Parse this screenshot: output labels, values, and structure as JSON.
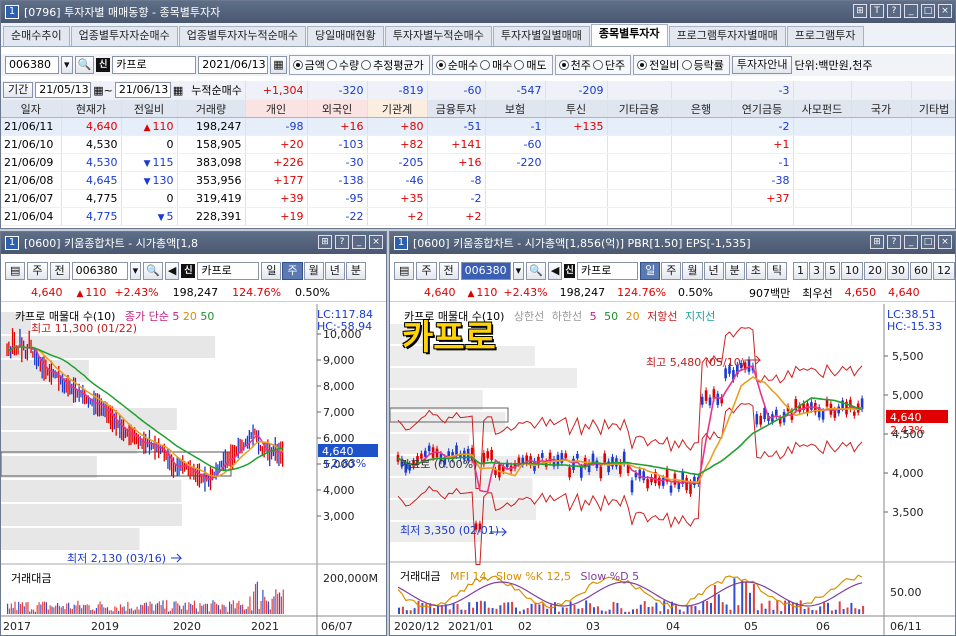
{
  "top": {
    "window_number": "1",
    "title": "[0796] 투자자별 매매동향 - 종목별투자자",
    "tabs": [
      "순매수추이",
      "업종별투자자순매수",
      "업종별투자자누적순매수",
      "당일매매현황",
      "투자자별누적순매수",
      "투자자별일별매매",
      "종목별투자자",
      "프로그램투자자별매매",
      "프로그램투자"
    ],
    "active_tab": 6,
    "code": "006380",
    "name": "카프로",
    "date": "2021/06/13",
    "radios1": [
      {
        "label": "금액",
        "on": true
      },
      {
        "label": "수량",
        "on": false
      },
      {
        "label": "추정평균가",
        "on": false
      }
    ],
    "radios2": [
      {
        "label": "순매수",
        "on": true
      },
      {
        "label": "매수",
        "on": false
      },
      {
        "label": "매도",
        "on": false
      }
    ],
    "radios3": [
      {
        "label": "천주",
        "on": true
      },
      {
        "label": "단주",
        "on": false
      }
    ],
    "radios4": [
      {
        "label": "전일비",
        "on": true
      },
      {
        "label": "등락률",
        "on": false
      }
    ],
    "guide_button": "투자자안내",
    "unit_text": "단위:백만원,천주",
    "period_label": "기간",
    "period_from": "21/05/13",
    "period_to": "21/06/13",
    "cum_label": "누적순매수",
    "columns": [
      "일자",
      "현재가",
      "전일비",
      "거래량",
      "개인",
      "외국인",
      "기관계",
      "금융투자",
      "보험",
      "투신",
      "기타금융",
      "은행",
      "연기금등",
      "사모펀드",
      "국가",
      "기타법"
    ],
    "cum_values": [
      "",
      "",
      "",
      "",
      "+1,304",
      "-320",
      "-819",
      "-60",
      "-547",
      "-209",
      "",
      "",
      "-3",
      "",
      "",
      ""
    ],
    "rows": [
      [
        "21/06/11",
        "4,640",
        "110",
        "198,247",
        "-98",
        "+16",
        "+80",
        "-51",
        "-1",
        "+135",
        "",
        "",
        "-2",
        "",
        "",
        ""
      ],
      [
        "21/06/10",
        "4,530",
        "0",
        "158,905",
        "+20",
        "-103",
        "+82",
        "+141",
        "-60",
        "",
        "",
        "",
        "+1",
        "",
        "",
        ""
      ],
      [
        "21/06/09",
        "4,530",
        "115",
        "383,098",
        "+226",
        "-30",
        "-205",
        "+16",
        "-220",
        "",
        "",
        "",
        "-1",
        "",
        "",
        ""
      ],
      [
        "21/06/08",
        "4,645",
        "130",
        "353,956",
        "+177",
        "-138",
        "-46",
        "-8",
        "",
        "",
        "",
        "",
        "-38",
        "",
        "",
        ""
      ],
      [
        "21/06/07",
        "4,775",
        "0",
        "319,419",
        "+39",
        "-95",
        "+35",
        "-2",
        "",
        "",
        "",
        "",
        "+37",
        "",
        "",
        ""
      ],
      [
        "21/06/04",
        "4,775",
        "5",
        "228,391",
        "+19",
        "-22",
        "+2",
        "+2",
        "",
        "",
        "",
        "",
        "",
        "",
        "",
        ""
      ]
    ],
    "row_dirs": [
      "up",
      "",
      "dn",
      "dn",
      "",
      "dn"
    ]
  },
  "left": {
    "window_number": "1",
    "title": "[0600] 키움종합차트 - 시가총액[1,8",
    "toolbar": {
      "btn1": "주",
      "btn2": "전",
      "code": "006380",
      "name": "카프로",
      "periods": [
        "일",
        "주",
        "월",
        "년",
        "분"
      ],
      "active_period": "주"
    },
    "price": {
      "price": "4,640",
      "change": "110",
      "rate": "+2.43%",
      "volume": "198,247",
      "vol_ratio": "124.76%",
      "turnover": "0.50%"
    },
    "legend": {
      "name": "카프로 매물대 수(10)",
      "ma": "종가 단순 5",
      "ma20": "20",
      "ma50": "50",
      "lc": "LC:117.84",
      "hc": "HC:-58.94"
    },
    "high_label": "최고 11,300 (01/22)",
    "low_label": "최저 2,130 (03/16)",
    "y_ticks": [
      "10,000",
      "9,000",
      "8,000",
      "7,000",
      "6,000",
      "5,000",
      "4,000",
      "3,000"
    ],
    "price_tag": "4,640",
    "rate_tag": "+2.83%",
    "vol_label": "거래대금",
    "vol_tick": "200,000M",
    "x_ticks": [
      "2017",
      "2019",
      "2020",
      "2021",
      "06/07"
    ]
  },
  "right": {
    "window_number": "1",
    "title": "[0600] 키움종합차트 - 시가총액[1,856(억)] PBR[1.50] EPS[-1,535]",
    "toolbar": {
      "btn1": "주",
      "btn2": "전",
      "code": "006380",
      "name": "카프로",
      "periods": [
        "일",
        "주",
        "월",
        "년",
        "분",
        "초",
        "틱"
      ],
      "active_period": "일",
      "nums": [
        "1",
        "3",
        "5",
        "10",
        "20",
        "30",
        "60",
        "12"
      ]
    },
    "price": {
      "price": "4,640",
      "change": "110",
      "rate": "+2.43%",
      "volume": "198,247",
      "vol_ratio": "124.76%",
      "turnover": "0.50%",
      "amount": "907백만",
      "best_label": "최우선",
      "best_price": "4,650",
      "last": "4,640"
    },
    "big_title": "카프로",
    "legend": {
      "name": "카프로 매물대 수(10)",
      "upper": "상한선",
      "lower": "하한선",
      "ma5": "5",
      "ma50": "50",
      "ma20": "20",
      "resist": "저항선",
      "support": "지지선",
      "lc": "LC:38.51",
      "hc": "HC:-15.33"
    },
    "high_label": "최고 5,480 (05/10)",
    "low_label": "최저 3,350 (02/01)",
    "box_label": "카프로 (0.00%)",
    "y_ticks": [
      "5,500",
      "5,000",
      "4,500",
      "4,000",
      "3,500"
    ],
    "price_tag": "4,640",
    "rate_tag": "2.43%",
    "sub_legend": {
      "vol": "거래대금",
      "mfi": "MFI 14",
      "slowk": "Slow %K 12,5",
      "slowd": "Slow %D 5"
    },
    "sub_tick": "50.00",
    "x_ticks": [
      "2020/12",
      "2021/01",
      "02",
      "03",
      "04",
      "05",
      "06",
      "06/11"
    ]
  },
  "colors": {
    "up": "#e00000",
    "down": "#1a3ad0",
    "ma5": "#e8348a",
    "ma20": "#e8a020",
    "ma50": "#20a030",
    "title_bg": "#4f5d76",
    "candle_up": "#e00000",
    "candle_dn": "#1a3ad0",
    "bb": "#cc2020"
  }
}
